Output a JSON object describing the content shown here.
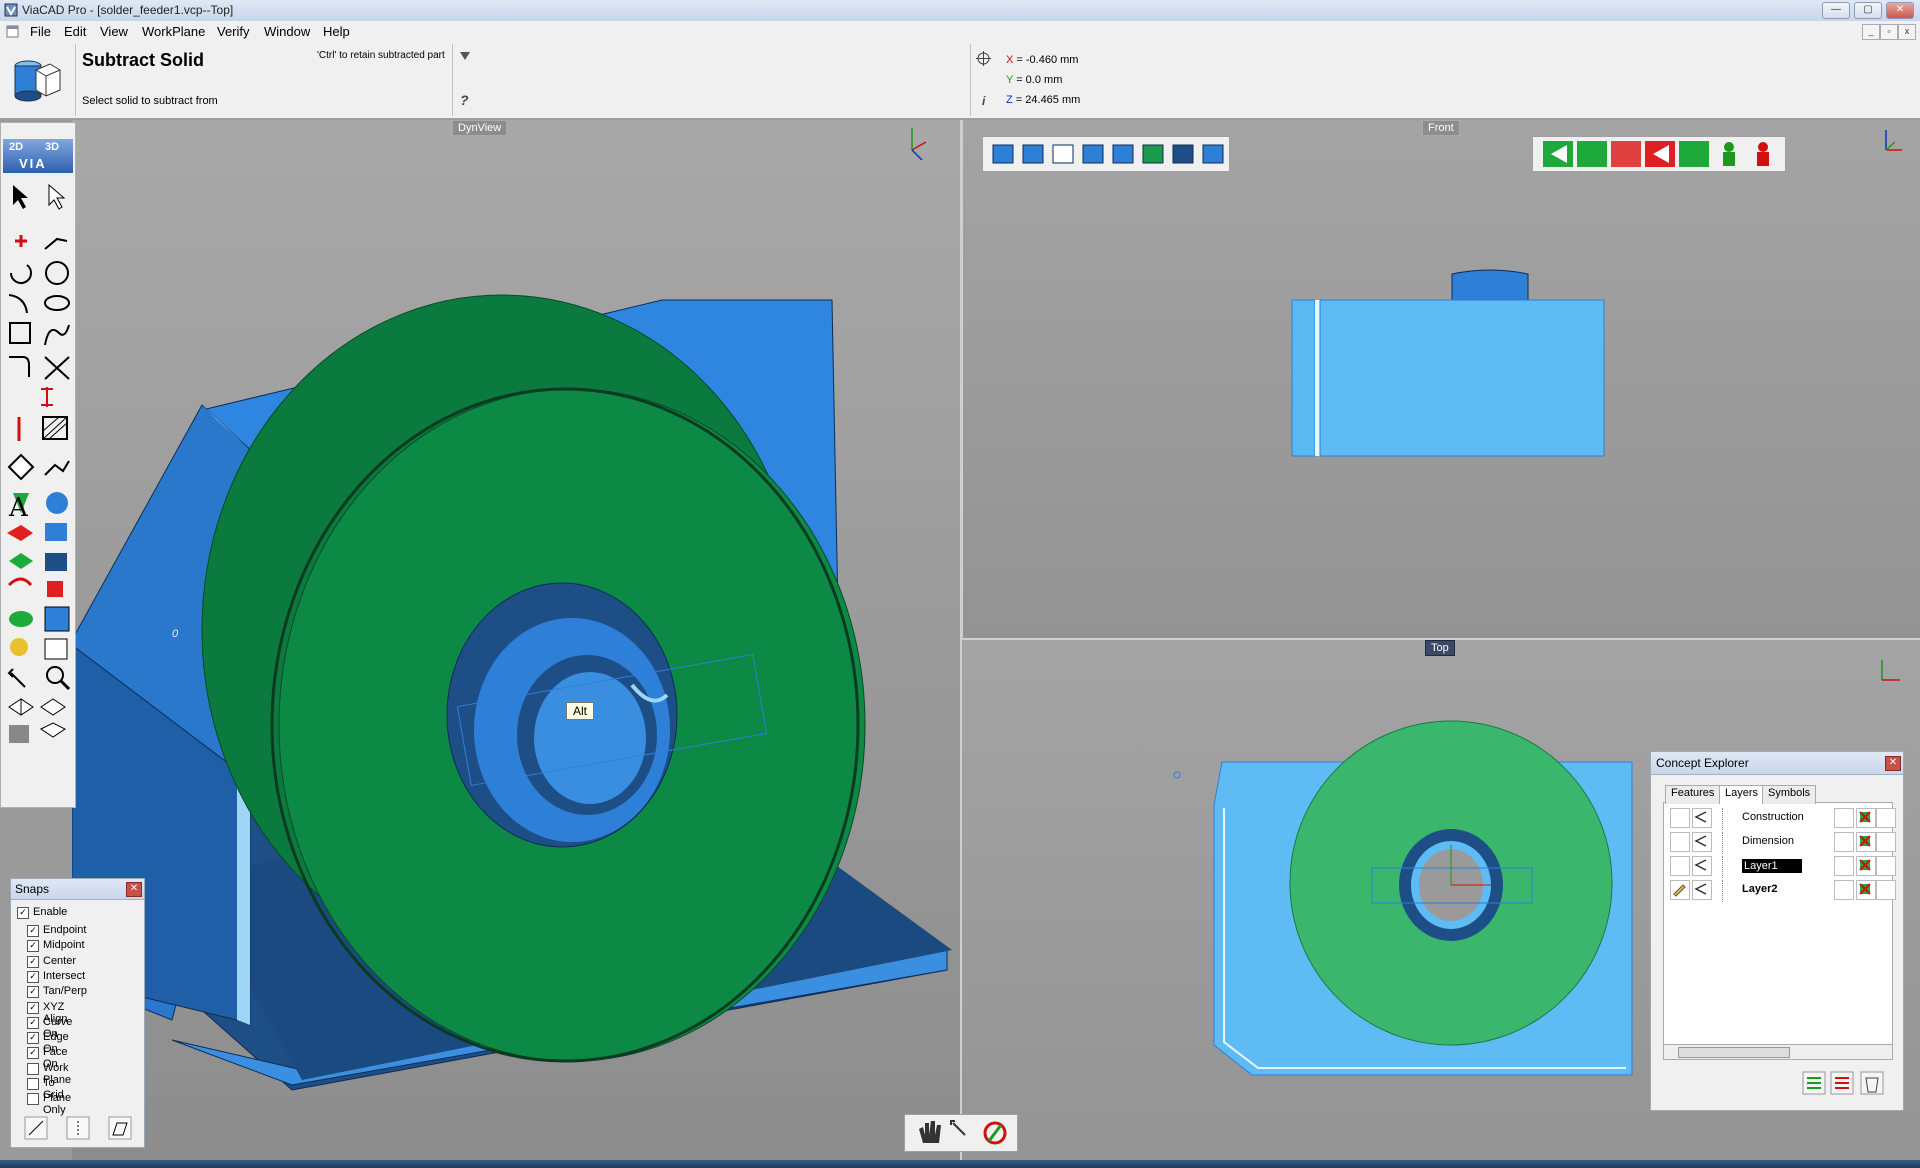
{
  "window": {
    "title": "ViaCAD Pro - [solder_feeder1.vcp--Top]",
    "minimize": "—",
    "maximize": "▢",
    "close": "✕"
  },
  "menu": {
    "items": [
      "File",
      "Edit",
      "View",
      "WorkPlane",
      "Verify",
      "Window",
      "Help"
    ]
  },
  "command": {
    "title": "Subtract Solid",
    "prompt": "Select solid to subtract from",
    "hint": "'Ctrl' to retain subtracted part",
    "help": "?",
    "info": "i"
  },
  "coords": {
    "x_label": "X",
    "x_value": "= -0.460 mm",
    "y_label": "Y",
    "y_value": "= 0.0 mm",
    "z_label": "Z",
    "z_value": "= 24.465 mm"
  },
  "viewports": {
    "dyn_label": "DynView",
    "front_label": "Front",
    "top_label": "Top",
    "tooltip": "Alt",
    "dyn_marker": "0"
  },
  "toolbar": {
    "mode_2d": "2D",
    "mode_3d": "3D",
    "via": "VIA",
    "text_tool": "A"
  },
  "snaps": {
    "title": "Snaps",
    "enable_label": "Enable",
    "items": [
      {
        "label": "Endpoint",
        "checked": true
      },
      {
        "label": "Midpoint",
        "checked": true
      },
      {
        "label": "Center",
        "checked": true
      },
      {
        "label": "Intersect",
        "checked": true
      },
      {
        "label": "Tan/Perp",
        "checked": true
      },
      {
        "label": "XYZ Align",
        "checked": true
      },
      {
        "label": "Curve On",
        "checked": true
      },
      {
        "label": "Edge On",
        "checked": true
      },
      {
        "label": "Face On",
        "checked": true
      },
      {
        "label": "Work Plane",
        "checked": false
      },
      {
        "label": "To Grid",
        "checked": false
      },
      {
        "label": "Plane Only",
        "checked": false
      }
    ]
  },
  "concept_explorer": {
    "title": "Concept Explorer",
    "tabs": [
      "Features",
      "Layers",
      "Symbols"
    ],
    "active_tab": "Layers",
    "layers": [
      {
        "name": "Construction",
        "bold": false,
        "selected": false
      },
      {
        "name": "Dimension",
        "bold": false,
        "selected": false
      },
      {
        "name": "Layer1",
        "bold": false,
        "selected": true
      },
      {
        "name": "Layer2",
        "bold": true,
        "selected": false
      }
    ]
  },
  "colors": {
    "green": "#0a8a45",
    "blue_dark": "#1f4f8a",
    "blue_mid": "#2e7fd8",
    "blue_light": "#5bb9f2",
    "viewport_bg": "#9a9a9a"
  }
}
